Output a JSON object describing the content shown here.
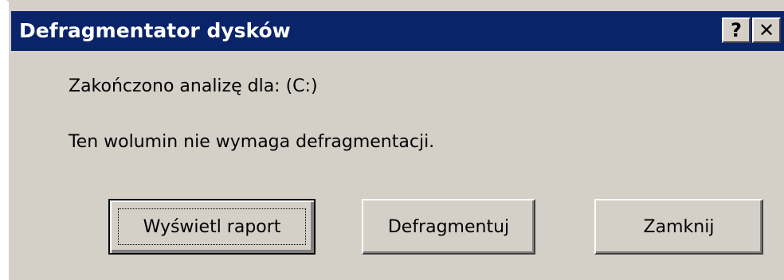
{
  "window": {
    "title": "Defragmentator dysków",
    "help_icon": "?",
    "close_icon": "✕"
  },
  "messages": {
    "line1": "Zakończono analizę dla: (C:)",
    "line2": "Ten wolumin nie wymaga defragmentacji."
  },
  "buttons": {
    "view_report": "Wyświetl raport",
    "defragment": "Defragmentuj",
    "close": "Zamknij"
  },
  "colors": {
    "titlebar": "#0a246a",
    "face": "#d4d0c8"
  }
}
